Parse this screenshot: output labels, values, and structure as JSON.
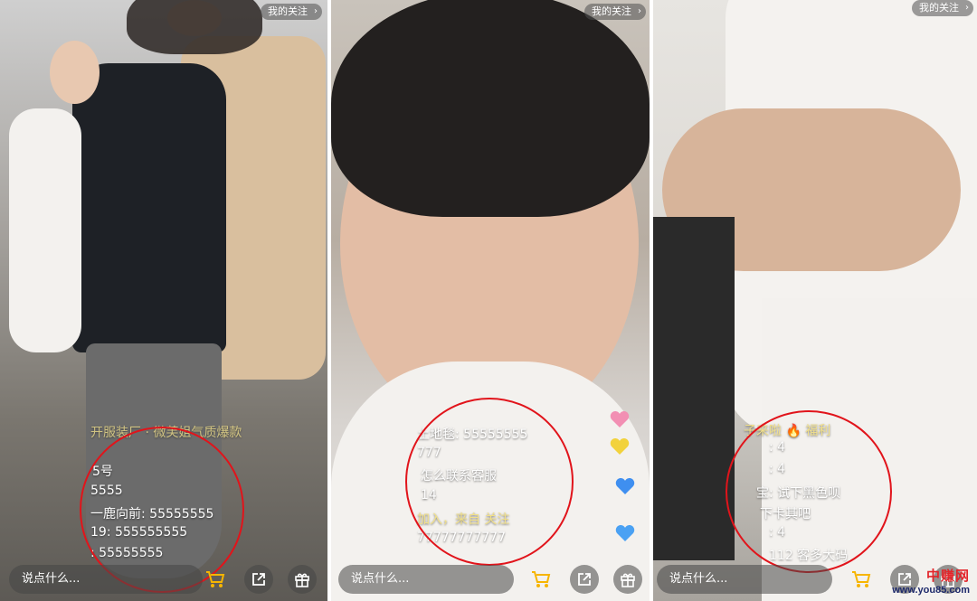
{
  "panels": [
    {
      "follow_label": "我的关注",
      "chat": [
        "开服装厂 · 微芙姐气质爆款",
        "5号",
        "5555",
        "一鹿向前: 55555555",
        "19: 555555555",
        ": 55555555"
      ],
      "input_placeholder": "说点什么..."
    },
    {
      "follow_label": "我的关注",
      "chat": [
        "土地毯: 55555555",
        "777",
        "怎么联系客服",
        "14",
        "加入，来自 关注",
        "77777777777"
      ],
      "input_placeholder": "说点什么..."
    },
    {
      "follow_label": "我的关注",
      "chat": [
        "子来啦 🔥 福利",
        ": 4",
        ": 4",
        "宝: 试下黑色呗",
        "下卡其吧",
        ": 4",
        "112 客多大码"
      ],
      "input_placeholder": "说点什么..."
    }
  ],
  "icons": {
    "cart": "shopping-cart-icon",
    "share": "share-icon",
    "gift": "gift-icon",
    "chevron": "chevron-right-icon"
  },
  "colors": {
    "annotation_circle": "#e1141b",
    "cart_accent": "#f7b500"
  },
  "watermark": {
    "title": "中赚网",
    "url": "www.you85.com"
  }
}
